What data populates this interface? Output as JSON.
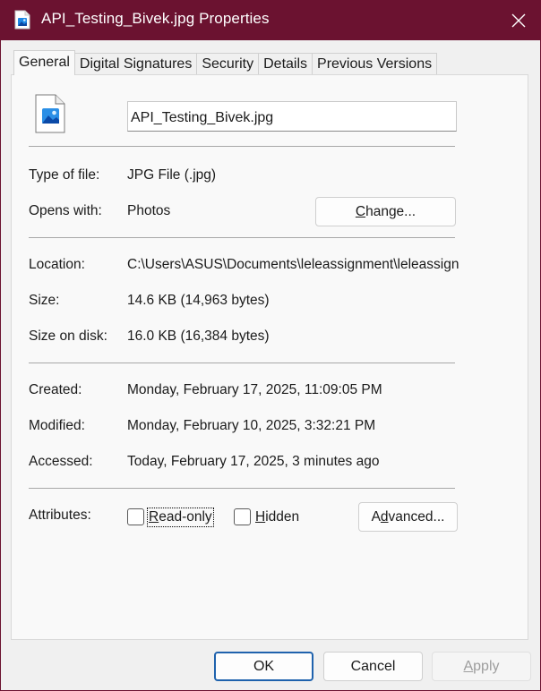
{
  "window": {
    "title": "API_Testing_Bivek.jpg Properties",
    "titlebar_color": "#6b1230"
  },
  "tabs": [
    {
      "label": "General",
      "active": true
    },
    {
      "label": "Digital Signatures",
      "active": false
    },
    {
      "label": "Security",
      "active": false
    },
    {
      "label": "Details",
      "active": false
    },
    {
      "label": "Previous Versions",
      "active": false
    }
  ],
  "general": {
    "file_name": "API_Testing_Bivek.jpg",
    "type_label": "Type of file:",
    "type_value": "JPG File (.jpg)",
    "opens_label": "Opens with:",
    "opens_value": "Photos",
    "change_button": {
      "pre": "",
      "key": "C",
      "post": "hange..."
    },
    "location_label": "Location:",
    "location_value": "C:\\Users\\ASUS\\Documents\\leleassignment\\leleassignment",
    "size_label": "Size:",
    "size_value": "14.6 KB (14,963 bytes)",
    "size_disk_label": "Size on disk:",
    "size_disk_value": "16.0 KB (16,384 bytes)",
    "created_label": "Created:",
    "created_value": "Monday, February 17, 2025, 11:09:05 PM",
    "modified_label": "Modified:",
    "modified_value": "Monday, February 10, 2025, 3:32:21 PM",
    "accessed_label": "Accessed:",
    "accessed_value": "Today, February 17, 2025, 3 minutes ago",
    "attributes_label": "Attributes:",
    "readonly": {
      "key": "R",
      "rest": "ead-only",
      "checked": false
    },
    "hidden": {
      "key": "H",
      "rest": "idden",
      "checked": false
    },
    "advanced_button": {
      "pre": "A",
      "key": "d",
      "post": "vanced..."
    }
  },
  "footer": {
    "ok": "OK",
    "cancel": "Cancel",
    "apply": {
      "key": "A",
      "rest": "pply"
    },
    "accent_color": "#1f62ad"
  },
  "icons": {
    "title_icon": "image-file-icon",
    "close_icon": "close-icon",
    "file_icon": "image-file-icon"
  }
}
